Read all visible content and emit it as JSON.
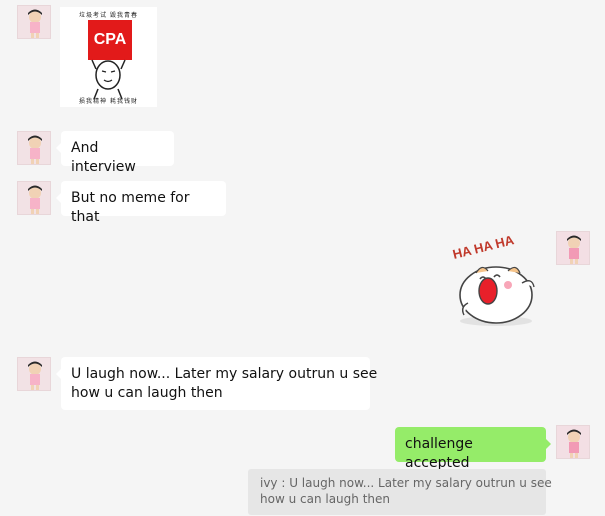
{
  "messages": [
    {
      "sender": "other",
      "type": "sticker",
      "sticker": "cpa-meme",
      "cpa_top_text": "垃圾考试  毁我青春",
      "cpa_sign_text": "CPA",
      "cpa_bottom_text": "损我精神  耗我钱财"
    },
    {
      "sender": "other",
      "type": "text",
      "text": "And interview"
    },
    {
      "sender": "other",
      "type": "text",
      "text": "But no meme for that"
    },
    {
      "sender": "me",
      "type": "sticker",
      "sticker": "hamster-ha-ha-ha",
      "sticker_text": "HA HA HA"
    },
    {
      "sender": "other",
      "type": "text",
      "line1": "U laugh now... Later my salary outrun u see",
      "line2": "how u can laugh then"
    },
    {
      "sender": "me",
      "type": "text",
      "text": "challenge accepted",
      "quote": {
        "line1": "ivy : U laugh now... Later my salary outrun u see",
        "line2": "how u can laugh then"
      }
    }
  ],
  "colors": {
    "background": "#f5f5f5",
    "incoming_bubble": "#ffffff",
    "outgoing_bubble": "#95ec69",
    "quote_bg": "#e6e6e6",
    "cpa_red": "#e21a1a"
  }
}
